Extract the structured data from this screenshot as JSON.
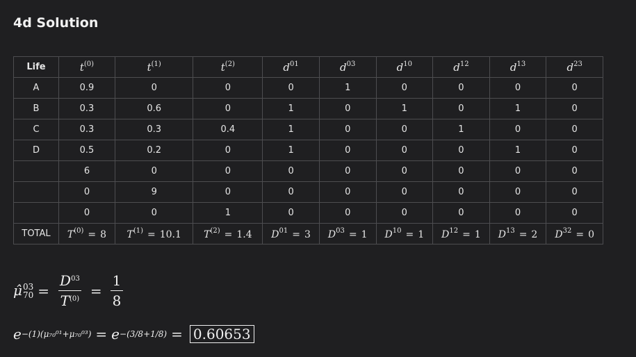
{
  "page_title": "4d Solution",
  "table": {
    "header_first": "Life",
    "headers": [
      {
        "base": "t",
        "sup": "(0)"
      },
      {
        "base": "t",
        "sup": "(1)"
      },
      {
        "base": "t",
        "sup": "(2)"
      },
      {
        "base": "d",
        "sup": "01"
      },
      {
        "base": "d",
        "sup": "03"
      },
      {
        "base": "d",
        "sup": "10"
      },
      {
        "base": "d",
        "sup": "12"
      },
      {
        "base": "d",
        "sup": "13"
      },
      {
        "base": "d",
        "sup": "23"
      }
    ],
    "rows": [
      {
        "life": "A",
        "values": [
          "0.9",
          "0",
          "0",
          "0",
          "1",
          "0",
          "0",
          "0",
          "0"
        ]
      },
      {
        "life": "B",
        "values": [
          "0.3",
          "0.6",
          "0",
          "1",
          "0",
          "1",
          "0",
          "1",
          "0"
        ]
      },
      {
        "life": "C",
        "values": [
          "0.3",
          "0.3",
          "0.4",
          "1",
          "0",
          "0",
          "1",
          "0",
          "0"
        ]
      },
      {
        "life": "D",
        "values": [
          "0.5",
          "0.2",
          "0",
          "1",
          "0",
          "0",
          "0",
          "1",
          "0"
        ]
      },
      {
        "life": "",
        "values": [
          "6",
          "0",
          "0",
          "0",
          "0",
          "0",
          "0",
          "0",
          "0"
        ]
      },
      {
        "life": "",
        "values": [
          "0",
          "9",
          "0",
          "0",
          "0",
          "0",
          "0",
          "0",
          "0"
        ]
      },
      {
        "life": "",
        "values": [
          "0",
          "0",
          "1",
          "0",
          "0",
          "0",
          "0",
          "0",
          "0"
        ]
      }
    ],
    "total_label": "TOTAL",
    "totals": [
      {
        "base": "T",
        "sup": "(0)",
        "value": "8"
      },
      {
        "base": "T",
        "sup": "(1)",
        "value": "10.1"
      },
      {
        "base": "T",
        "sup": "(2)",
        "value": "1.4"
      },
      {
        "base": "D",
        "sup": "01",
        "value": "3"
      },
      {
        "base": "D",
        "sup": "03",
        "value": "1"
      },
      {
        "base": "D",
        "sup": "10",
        "value": "1"
      },
      {
        "base": "D",
        "sup": "12",
        "value": "1"
      },
      {
        "base": "D",
        "sup": "13",
        "value": "2"
      },
      {
        "base": "D",
        "sup": "32",
        "value": "0"
      }
    ]
  },
  "estimate": {
    "symbol": "μ̂",
    "sup": "03",
    "sub": "70",
    "num_base": "D",
    "num_sup": "03",
    "den_base": "T",
    "den_sup": "(0)",
    "result_num": "1",
    "result_den": "8"
  },
  "probability": {
    "lhs_base": "e",
    "lhs_exponent": "−(1)(μ₇₀⁰¹+μ₇₀⁰³)",
    "mid_base": "e",
    "mid_exponent": "−(3/8+1/8)",
    "result": "0.60653"
  }
}
